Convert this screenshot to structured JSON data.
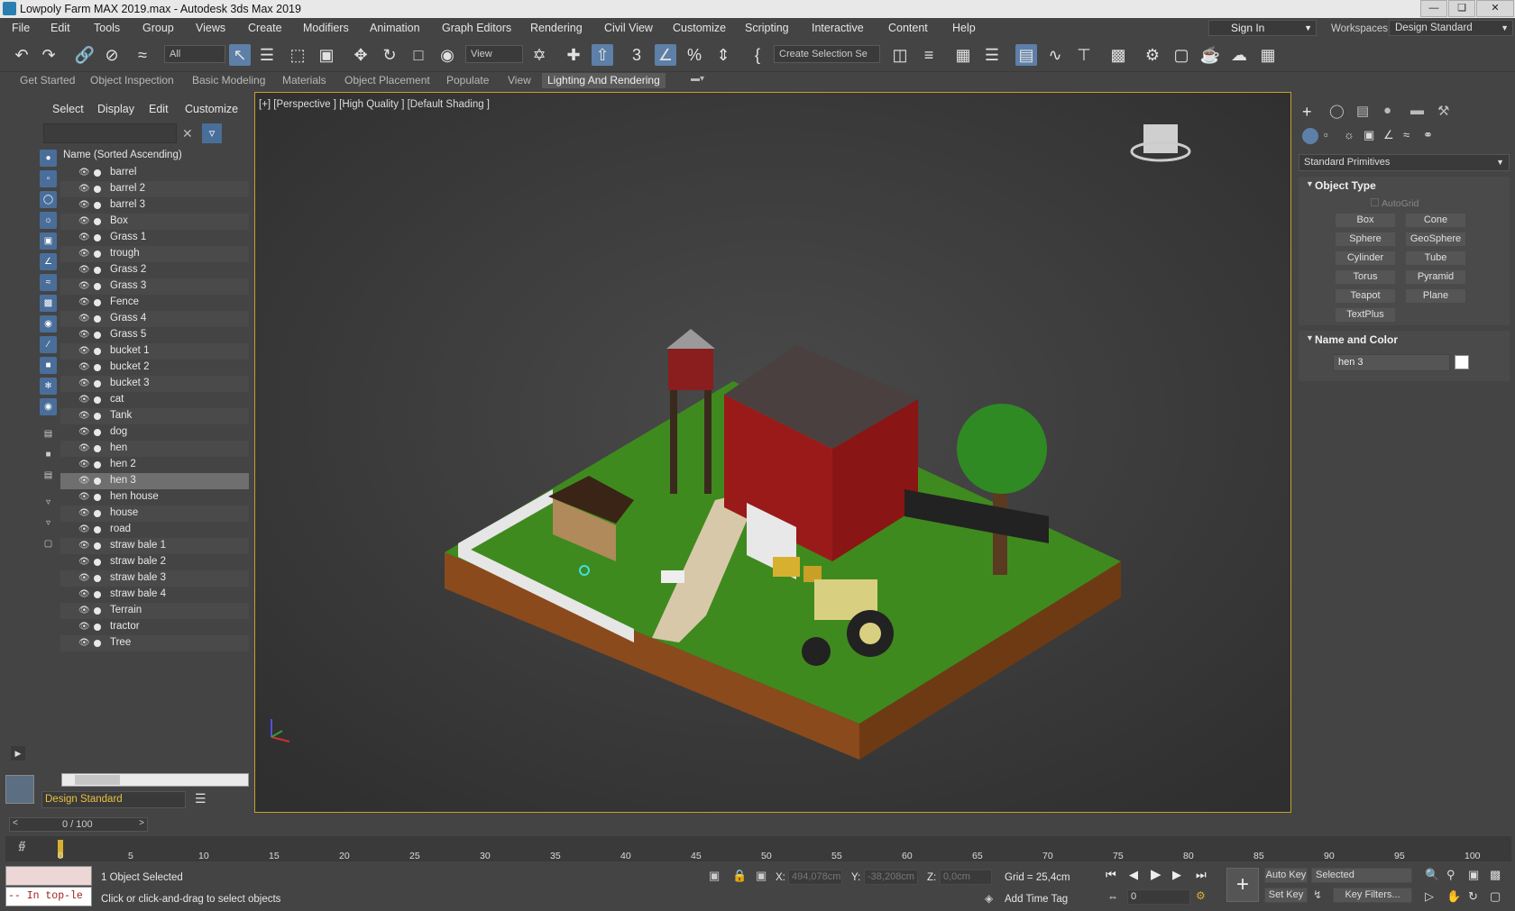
{
  "window": {
    "title": "Lowpoly Farm MAX 2019.max - Autodesk 3ds Max 2019"
  },
  "menubar": {
    "items": [
      "File",
      "Edit",
      "Tools",
      "Group",
      "Views",
      "Create",
      "Modifiers",
      "Animation",
      "Graph Editors",
      "Rendering",
      "Civil View",
      "Customize",
      "Scripting",
      "Interactive",
      "Content",
      "Help"
    ],
    "sign_in": "Sign In",
    "workspaces_label": "Workspaces:",
    "workspace_value": "Design Standard"
  },
  "toolbar": {
    "filter_value": "All",
    "view_value": "View",
    "selection_set_placeholder": "Create Selection Se"
  },
  "ribbon": {
    "tabs": [
      "Get Started",
      "Object Inspection",
      "Basic Modeling",
      "Materials",
      "Object Placement",
      "Populate",
      "View",
      "Lighting And Rendering"
    ]
  },
  "explorer": {
    "menus": [
      "Select",
      "Display",
      "Edit",
      "Customize"
    ],
    "column_header": "Name (Sorted Ascending)",
    "objects": [
      "barrel",
      "barrel 2",
      "barrel 3",
      "Box",
      "Grass 1",
      "trough",
      "Grass 2",
      "Grass 3",
      "Fence",
      "Grass 4",
      "Grass 5",
      "bucket 1",
      "bucket 2",
      "bucket 3",
      "cat",
      "Tank",
      "dog",
      "hen",
      "hen 2",
      "hen 3",
      "hen house",
      "house",
      "road",
      "straw bale 1",
      "straw bale 2",
      "straw bale 3",
      "straw bale 4",
      "Terrain",
      "tractor",
      "Tree"
    ],
    "selected": "hen 3",
    "layer_dropdown": "Design Standard"
  },
  "viewport": {
    "label": "[+] [Perspective ] [High Quality ] [Default Shading ]"
  },
  "command_panel": {
    "category_dropdown": "Standard Primitives",
    "object_type_title": "Object Type",
    "autogrid_label": "AutoGrid",
    "buttons": [
      "Box",
      "Cone",
      "Sphere",
      "GeoSphere",
      "Cylinder",
      "Tube",
      "Torus",
      "Pyramid",
      "Teapot",
      "Plane",
      "TextPlus"
    ],
    "name_color_title": "Name and Color",
    "name_value": "hen 3",
    "swatch_color": "#ffffff"
  },
  "timeline": {
    "frame_display": "0 / 100",
    "ticks": [
      "0",
      "5",
      "10",
      "15",
      "20",
      "25",
      "30",
      "35",
      "40",
      "45",
      "50",
      "55",
      "60",
      "65",
      "70",
      "75",
      "80",
      "85",
      "90",
      "95",
      "100"
    ]
  },
  "status": {
    "selected_count": "1 Object Selected",
    "hint": "Click or click-and-drag to select objects",
    "maxscript_text": "-- In top-le",
    "x_label": "X:",
    "x_value": "494,078cm",
    "y_label": "Y:",
    "y_value": "-38,208cm",
    "z_label": "Z:",
    "z_value": "0,0cm",
    "grid": "Grid = 25,4cm",
    "add_time_tag": "Add Time Tag",
    "auto_key": "Auto Key",
    "set_key": "Set Key",
    "key_mode": "Selected",
    "key_filters": "Key Filters...",
    "frame_field": "0"
  },
  "colors": {
    "viewport_border": "#c0a030",
    "selected_row": "#6f6f6f",
    "active_tool": "#5d7fa8"
  }
}
